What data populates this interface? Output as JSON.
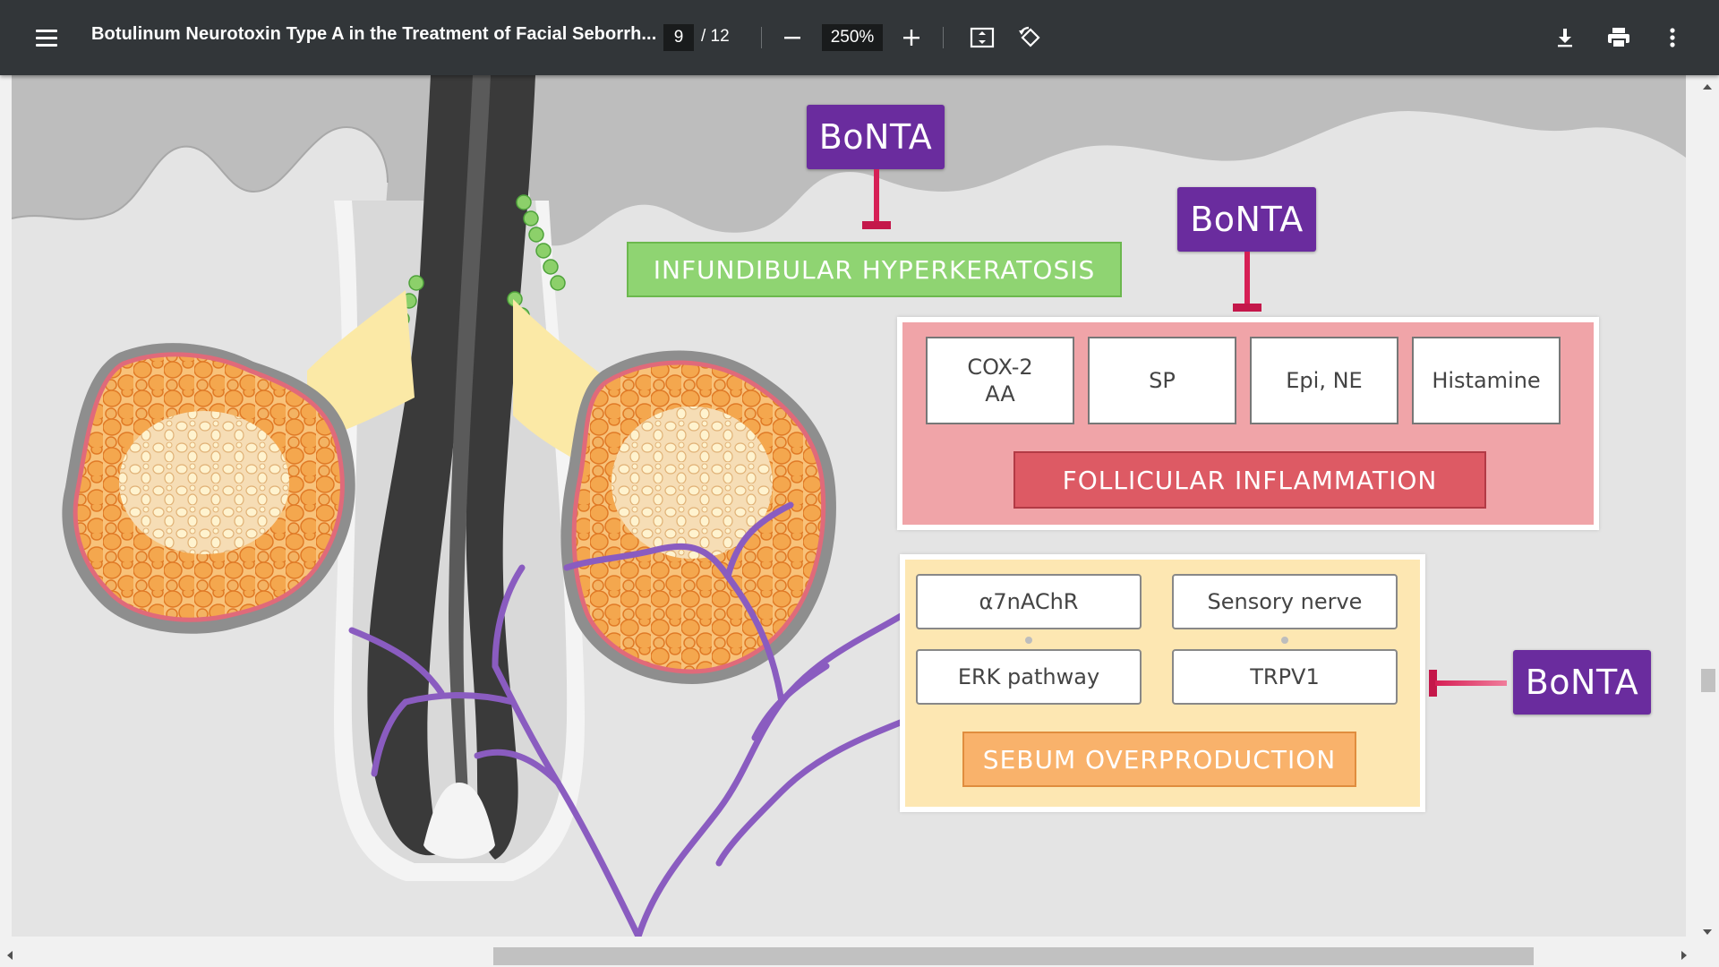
{
  "toolbar": {
    "title": "Botulinum Neurotoxin Type A in the Treatment of Facial Seborrh...",
    "page_current": "9",
    "page_total": "/ 12",
    "zoom": "250%",
    "icons": [
      "menu-icon",
      "zoom-out-icon",
      "zoom-in-icon",
      "fit-page-icon",
      "rotate-icon",
      "download-icon",
      "print-icon",
      "more-vert-icon"
    ]
  },
  "figure": {
    "bonta_label": "BoNTA",
    "infundibular": "INFUNDIBULAR HYPERKERATOSIS",
    "inflammation_mediators": [
      "COX-2\nAA",
      "SP",
      "Epi, NE",
      "Histamine"
    ],
    "follicular_inflammation": "FOLLICULAR INFLAMMATION",
    "sebum_factors": [
      "α7nAChR",
      "Sensory nerve",
      "ERK pathway",
      "TRPV1"
    ],
    "sebum_overproduction": "SEBUM OVERPRODUCTION",
    "colors": {
      "bonta": "#6a2c9e",
      "inhibitor": "#d61f55",
      "infundibular": "#8fd472",
      "inflammation_panel": "#f0a4a8",
      "inflammation_label": "#dd5a64",
      "sebum_panel": "#fde7b2",
      "sebum_label": "#f9b26b",
      "nerve": "#8a5cc0"
    }
  }
}
